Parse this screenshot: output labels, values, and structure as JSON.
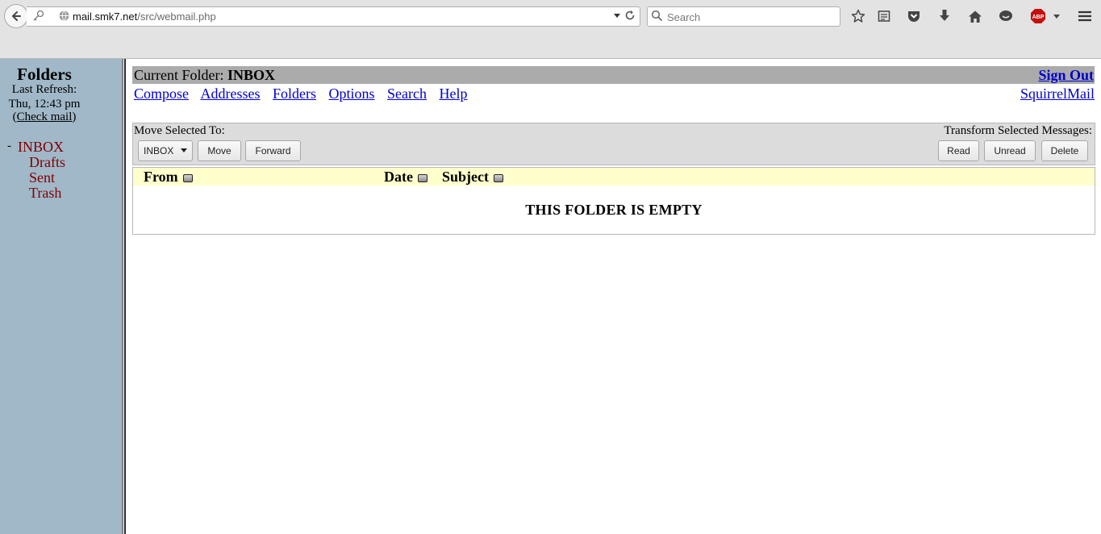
{
  "browser": {
    "url_domain": "mail.smk7.net",
    "url_path": "/src/webmail.php",
    "search_placeholder": "Search",
    "abp_label": "ABP"
  },
  "sidebar": {
    "title": "Folders",
    "last_refresh_label": "Last Refresh:",
    "last_refresh_time": "Thu, 12:43 pm",
    "check_mail_open": "(",
    "check_mail_label": "Check mail",
    "check_mail_close": ")",
    "current_marker": "-",
    "folders": [
      "INBOX",
      "Drafts",
      "Sent",
      "Trash"
    ]
  },
  "header": {
    "current_folder_label": "Current Folder:",
    "current_folder": "INBOX",
    "sign_out": "Sign Out"
  },
  "nav": {
    "links": [
      "Compose",
      "Addresses",
      "Folders",
      "Options",
      "Search",
      "Help"
    ],
    "brand_link": "SquirrelMail"
  },
  "actions": {
    "move_label": "Move Selected To:",
    "move_target": "INBOX",
    "move_button": "Move",
    "forward_button": "Forward",
    "transform_label": "Transform Selected Messages:",
    "read_button": "Read",
    "unread_button": "Unread",
    "delete_button": "Delete"
  },
  "message_list": {
    "columns": [
      "From",
      "Date",
      "Subject"
    ],
    "empty_text": "THIS FOLDER IS EMPTY"
  },
  "colors": {
    "sidebar_bg": "#a0b8c8",
    "folder_link": "#800000",
    "header_bar": "#ababab",
    "column_header_bg": "#ffffcc",
    "link": "#0000cc"
  }
}
